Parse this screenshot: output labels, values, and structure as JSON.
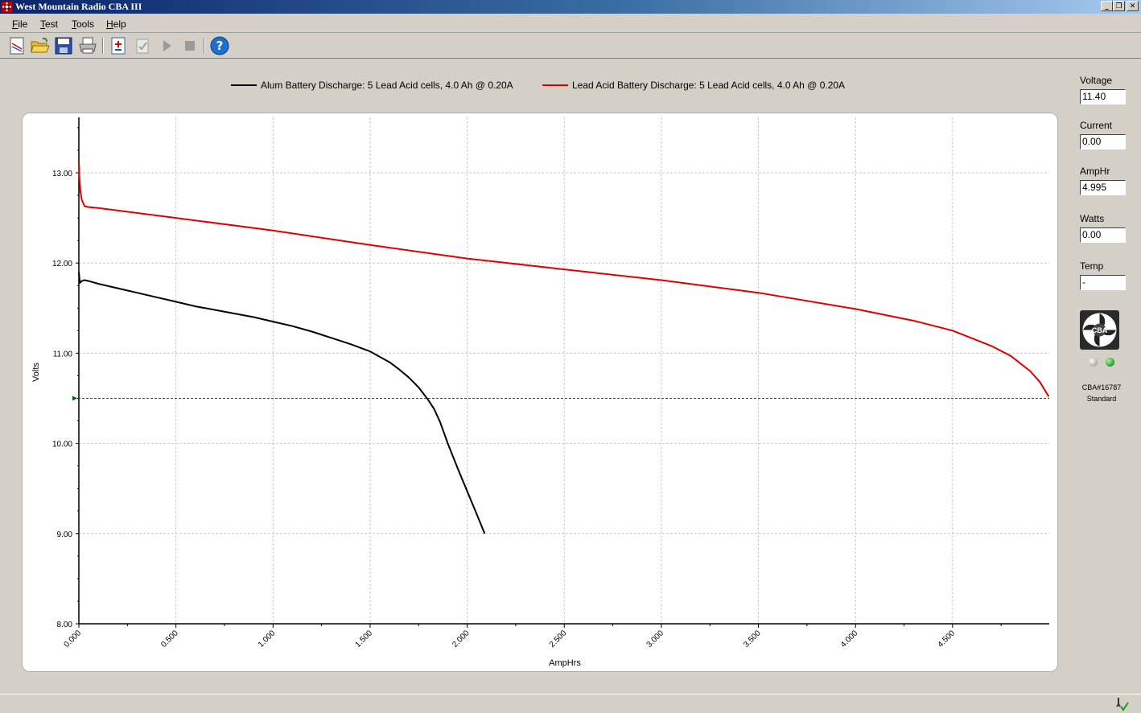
{
  "window": {
    "title": "West Mountain Radio CBA III",
    "buttons": [
      "minimize",
      "restore",
      "close"
    ]
  },
  "menu": [
    {
      "key": "F",
      "rest": "ile"
    },
    {
      "key": "T",
      "rest": "est"
    },
    {
      "key": "T",
      "rest": "ools"
    },
    {
      "key": "H",
      "rest": "elp"
    }
  ],
  "toolbar": {
    "icons": [
      "new-graph-icon",
      "open-folder-icon",
      "save-icon",
      "print-icon",
      "add-cba-icon",
      "test-check-icon",
      "play-icon",
      "stop-icon",
      "help-icon"
    ]
  },
  "readouts": {
    "voltage_label": "Voltage",
    "voltage_value": "11.40",
    "current_label": "Current",
    "current_value": "0.00",
    "amphr_label": "AmpHr",
    "amphr_value": "4.995",
    "watts_label": "Watts",
    "watts_value": "0.00",
    "temp_label": "Temp",
    "temp_value": "-",
    "logo_text": "CBA",
    "device_id": "CBA#16787",
    "device_type": "Standard"
  },
  "colors": {
    "series_alum": "#000000",
    "series_lead": "#e00000",
    "cutoff_line": "#006400"
  },
  "chart_data": {
    "type": "line",
    "xlabel": "AmpHrs",
    "ylabel": "Volts",
    "xlim": [
      0,
      5.0
    ],
    "ylim": [
      8.0,
      13.5
    ],
    "x_ticks": [
      "0.000",
      "0.500",
      "1.000",
      "1.500",
      "2.000",
      "2.500",
      "3.000",
      "3.500",
      "4.000",
      "4.500"
    ],
    "y_ticks": [
      "8.00",
      "9.00",
      "10.00",
      "11.00",
      "12.00",
      "13.00"
    ],
    "grid": true,
    "cutoff_voltage": 10.5,
    "legend_position": "top",
    "series": [
      {
        "name": "Alum Battery Discharge: 5 Lead Acid cells, 4.0 Ah @ 0.20A",
        "color": "#000000",
        "x": [
          0,
          0.005,
          0.015,
          0.03,
          0.05,
          0.1,
          0.2,
          0.3,
          0.4,
          0.5,
          0.6,
          0.7,
          0.8,
          0.9,
          1.0,
          1.1,
          1.2,
          1.3,
          1.4,
          1.5,
          1.6,
          1.65,
          1.7,
          1.75,
          1.8,
          1.83,
          1.86,
          1.9,
          1.95,
          2.0,
          2.05,
          2.09
        ],
        "y": [
          11.9,
          11.78,
          11.8,
          11.81,
          11.8,
          11.77,
          11.72,
          11.67,
          11.62,
          11.57,
          11.52,
          11.48,
          11.44,
          11.4,
          11.35,
          11.3,
          11.24,
          11.17,
          11.1,
          11.02,
          10.9,
          10.82,
          10.73,
          10.62,
          10.48,
          10.38,
          10.24,
          10.0,
          9.73,
          9.47,
          9.21,
          9.0
        ]
      },
      {
        "name": "Lead Acid Battery Discharge: 5 Lead Acid cells, 4.0 Ah @ 0.20A",
        "color": "#e00000",
        "x": [
          0,
          0.003,
          0.008,
          0.015,
          0.03,
          0.05,
          0.1,
          0.5,
          1.0,
          1.5,
          2.0,
          2.5,
          3.0,
          3.5,
          4.0,
          4.3,
          4.5,
          4.7,
          4.8,
          4.9,
          4.95,
          4.995
        ],
        "y": [
          13.1,
          12.95,
          12.8,
          12.7,
          12.63,
          12.62,
          12.61,
          12.5,
          12.36,
          12.2,
          12.05,
          11.93,
          11.81,
          11.67,
          11.49,
          11.36,
          11.25,
          11.08,
          10.97,
          10.8,
          10.68,
          10.52
        ]
      }
    ]
  }
}
